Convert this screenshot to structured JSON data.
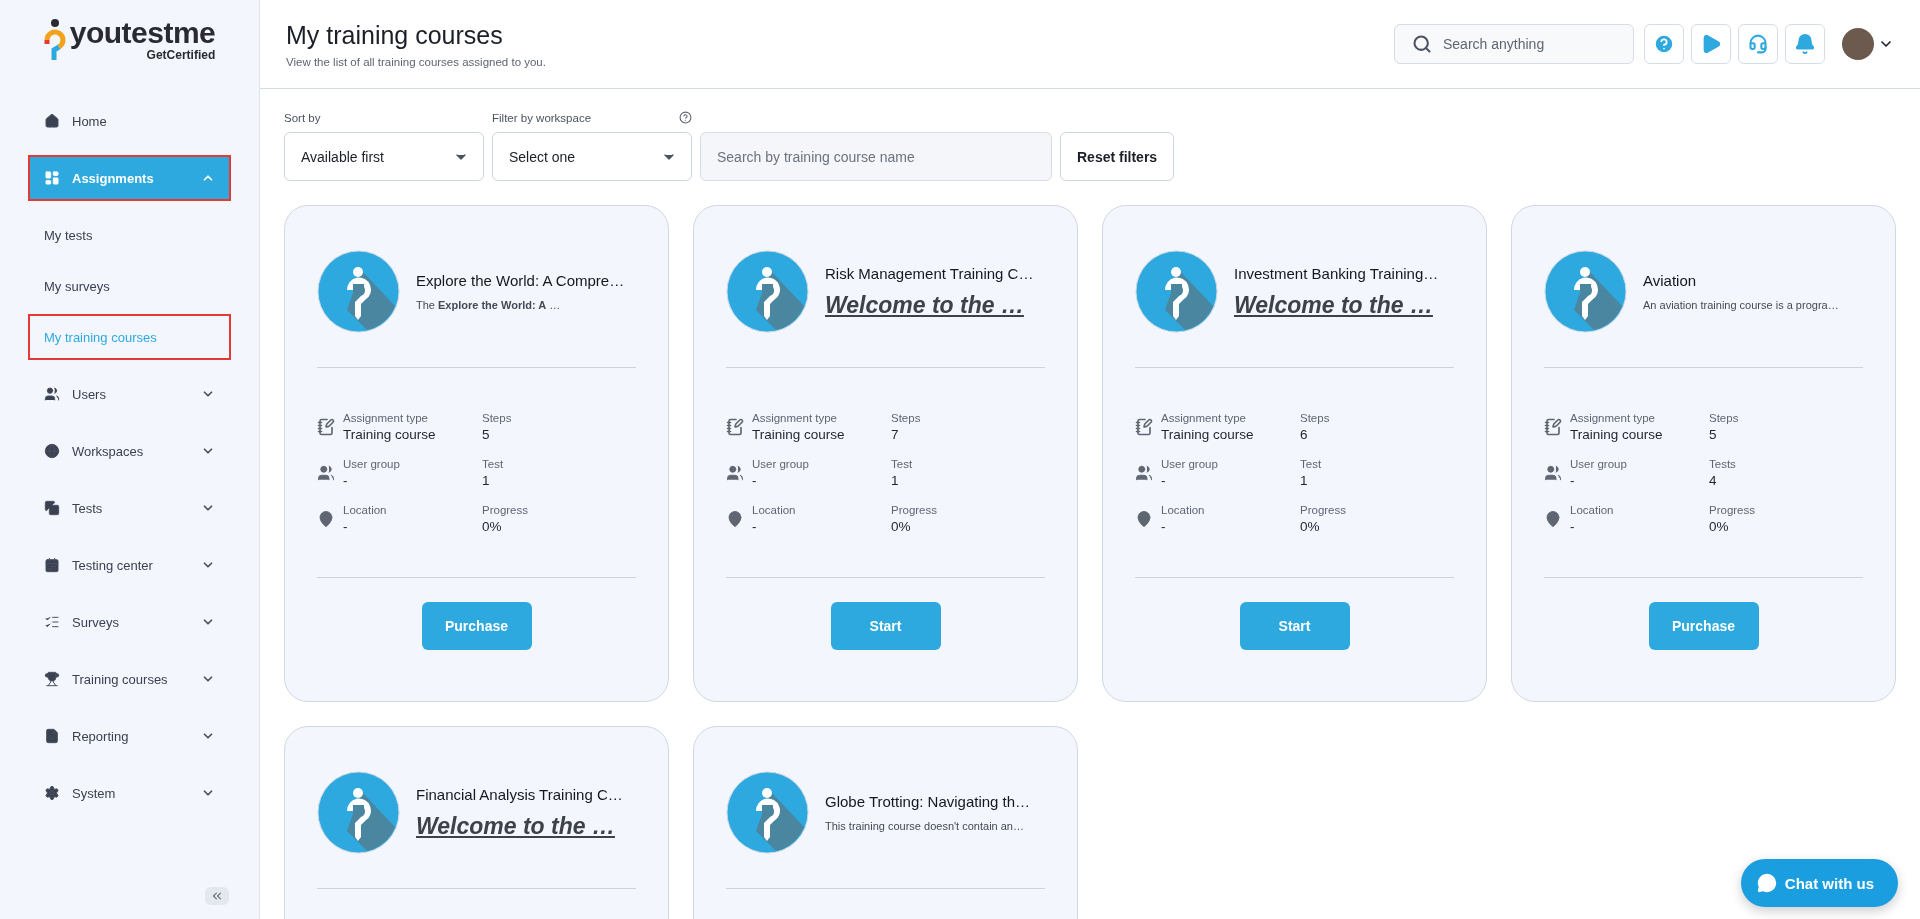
{
  "logo": {
    "name": "youtestme",
    "tagline": "GetCertified"
  },
  "sidebar": {
    "items": [
      {
        "label": "Home",
        "selected": false,
        "highlighted": false
      },
      {
        "label": "Assignments",
        "selected": true,
        "highlighted": true,
        "expanded": true,
        "children": [
          {
            "label": "My tests",
            "selected": false,
            "highlighted": false
          },
          {
            "label": "My surveys",
            "selected": false,
            "highlighted": false
          },
          {
            "label": "My training courses",
            "selected": true,
            "highlighted": true
          }
        ]
      },
      {
        "label": "Users",
        "selected": false,
        "highlighted": false,
        "expanded": false
      },
      {
        "label": "Workspaces",
        "selected": false,
        "highlighted": false,
        "expanded": false
      },
      {
        "label": "Tests",
        "selected": false,
        "highlighted": false,
        "expanded": false
      },
      {
        "label": "Testing center",
        "selected": false,
        "highlighted": false,
        "expanded": false
      },
      {
        "label": "Surveys",
        "selected": false,
        "highlighted": false,
        "expanded": false
      },
      {
        "label": "Training courses",
        "selected": false,
        "highlighted": false,
        "expanded": false
      },
      {
        "label": "Reporting",
        "selected": false,
        "highlighted": false,
        "expanded": false
      },
      {
        "label": "System",
        "selected": false,
        "highlighted": false,
        "expanded": false
      }
    ]
  },
  "header": {
    "title": "My training courses",
    "subtitle": "View the list of all training courses assigned to you.",
    "search": {
      "placeholder": "Search anything"
    }
  },
  "filters": {
    "sort": {
      "label": "Sort by",
      "value": "Available first"
    },
    "workspace": {
      "label": "Filter by workspace",
      "value": "Select one"
    },
    "search": {
      "placeholder": "Search by training course name"
    },
    "reset": "Reset filters"
  },
  "cards": [
    {
      "title": "Explore the World: A Compre…",
      "description": {
        "kind": "plain",
        "text": "The **Explore the World: A** …"
      },
      "stats": [
        {
          "label": "Assignment type",
          "value": "Training course"
        },
        {
          "label": "Steps",
          "value": "5"
        },
        {
          "label": "User group",
          "value": "-"
        },
        {
          "label": "Test",
          "value": "1"
        },
        {
          "label": "Location",
          "value": "-"
        },
        {
          "label": "Progress",
          "value": "0%"
        }
      ],
      "action": "Purchase"
    },
    {
      "title": "Risk Management Training C…",
      "description": {
        "kind": "heading",
        "text": "Welcome to the …"
      },
      "stats": [
        {
          "label": "Assignment type",
          "value": "Training course"
        },
        {
          "label": "Steps",
          "value": "7"
        },
        {
          "label": "User group",
          "value": "-"
        },
        {
          "label": "Test",
          "value": "1"
        },
        {
          "label": "Location",
          "value": "-"
        },
        {
          "label": "Progress",
          "value": "0%"
        }
      ],
      "action": "Start"
    },
    {
      "title": "Investment Banking Training…",
      "description": {
        "kind": "heading",
        "text": "Welcome to the …"
      },
      "stats": [
        {
          "label": "Assignment type",
          "value": "Training course"
        },
        {
          "label": "Steps",
          "value": "6"
        },
        {
          "label": "User group",
          "value": "-"
        },
        {
          "label": "Test",
          "value": "1"
        },
        {
          "label": "Location",
          "value": "-"
        },
        {
          "label": "Progress",
          "value": "0%"
        }
      ],
      "action": "Start"
    },
    {
      "title": "Aviation",
      "description": {
        "kind": "plain",
        "text": "An aviation training course is a progra…"
      },
      "stats": [
        {
          "label": "Assignment type",
          "value": "Training course"
        },
        {
          "label": "Steps",
          "value": "5"
        },
        {
          "label": "User group",
          "value": "-"
        },
        {
          "label": "Tests",
          "value": "4"
        },
        {
          "label": "Location",
          "value": "-"
        },
        {
          "label": "Progress",
          "value": "0%"
        }
      ],
      "action": "Purchase"
    },
    {
      "title": "Financial Analysis Training C…",
      "description": {
        "kind": "heading",
        "text": "Welcome to the …"
      }
    },
    {
      "title": "Globe Trotting: Navigating th…",
      "description": {
        "kind": "plain",
        "text": "This training course doesn't contain an…"
      }
    }
  ],
  "chat": {
    "label": "Chat with us"
  }
}
